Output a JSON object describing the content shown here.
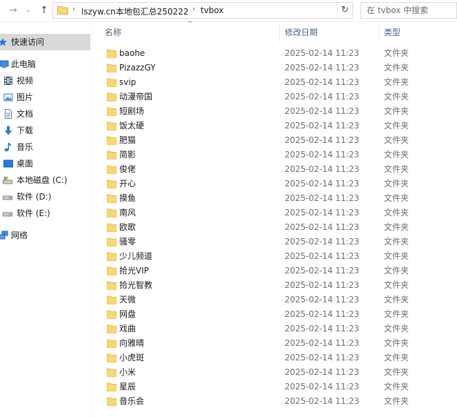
{
  "address": {
    "segments": [
      "lszyw.cn本地包汇总250222",
      "tvbox"
    ],
    "search_placeholder": "在 tvbox 中搜索"
  },
  "sidebar": {
    "items": [
      {
        "label": "快速访问",
        "icon": "star-icon",
        "selected": true
      },
      {
        "label": "此电脑",
        "icon": "computer-icon"
      },
      {
        "label": "视频",
        "icon": "video-icon"
      },
      {
        "label": "图片",
        "icon": "pictures-icon"
      },
      {
        "label": "文档",
        "icon": "documents-icon"
      },
      {
        "label": "下载",
        "icon": "download-icon"
      },
      {
        "label": "音乐",
        "icon": "music-icon"
      },
      {
        "label": "桌面",
        "icon": "desktop-icon"
      },
      {
        "label": "本地磁盘 (C:)",
        "icon": "system-drive-icon"
      },
      {
        "label": "软件 (D:)",
        "icon": "drive-icon"
      },
      {
        "label": "软件 (E:)",
        "icon": "drive-icon"
      },
      {
        "label": "网络",
        "icon": "network-icon"
      }
    ]
  },
  "columns": {
    "name": "名称",
    "date": "修改日期",
    "type": "类型"
  },
  "files": [
    {
      "name": "baohe",
      "date": "2025-02-14 11:23",
      "type": "文件夹"
    },
    {
      "name": "PizazzGY",
      "date": "2025-02-14 11:23",
      "type": "文件夹"
    },
    {
      "name": "svip",
      "date": "2025-02-14 11:23",
      "type": "文件夹"
    },
    {
      "name": "动漫帝国",
      "date": "2025-02-14 11:23",
      "type": "文件夹"
    },
    {
      "name": "短剧场",
      "date": "2025-02-14 11:23",
      "type": "文件夹"
    },
    {
      "name": "饭太硬",
      "date": "2025-02-14 11:23",
      "type": "文件夹"
    },
    {
      "name": "肥猫",
      "date": "2025-02-14 11:23",
      "type": "文件夹"
    },
    {
      "name": "简影",
      "date": "2025-02-14 11:23",
      "type": "文件夹"
    },
    {
      "name": "俊佬",
      "date": "2025-02-14 11:23",
      "type": "文件夹"
    },
    {
      "name": "开心",
      "date": "2025-02-14 11:23",
      "type": "文件夹"
    },
    {
      "name": "摸鱼",
      "date": "2025-02-14 11:23",
      "type": "文件夹"
    },
    {
      "name": "南风",
      "date": "2025-02-14 11:23",
      "type": "文件夹"
    },
    {
      "name": "欧歌",
      "date": "2025-02-14 11:23",
      "type": "文件夹"
    },
    {
      "name": "骚零",
      "date": "2025-02-14 11:23",
      "type": "文件夹"
    },
    {
      "name": "少儿频道",
      "date": "2025-02-14 11:23",
      "type": "文件夹"
    },
    {
      "name": "拾光VIP",
      "date": "2025-02-14 11:23",
      "type": "文件夹"
    },
    {
      "name": "拾光智教",
      "date": "2025-02-14 11:23",
      "type": "文件夹"
    },
    {
      "name": "天微",
      "date": "2025-02-14 11:23",
      "type": "文件夹"
    },
    {
      "name": "网盘",
      "date": "2025-02-14 11:23",
      "type": "文件夹"
    },
    {
      "name": "戏曲",
      "date": "2025-02-14 11:23",
      "type": "文件夹"
    },
    {
      "name": "向雅晴",
      "date": "2025-02-14 11:23",
      "type": "文件夹"
    },
    {
      "name": "小虎斑",
      "date": "2025-02-14 11:23",
      "type": "文件夹"
    },
    {
      "name": "小米",
      "date": "2025-02-14 11:23",
      "type": "文件夹"
    },
    {
      "name": "星辰",
      "date": "2025-02-14 11:23",
      "type": "文件夹"
    },
    {
      "name": "音乐会",
      "date": "2025-02-14 11:23",
      "type": "文件夹"
    }
  ],
  "colors": {
    "folder": "#f8d775",
    "folder_dark": "#e8b94a",
    "selected": "#d9d9d9",
    "header_text": "#4d6183"
  }
}
